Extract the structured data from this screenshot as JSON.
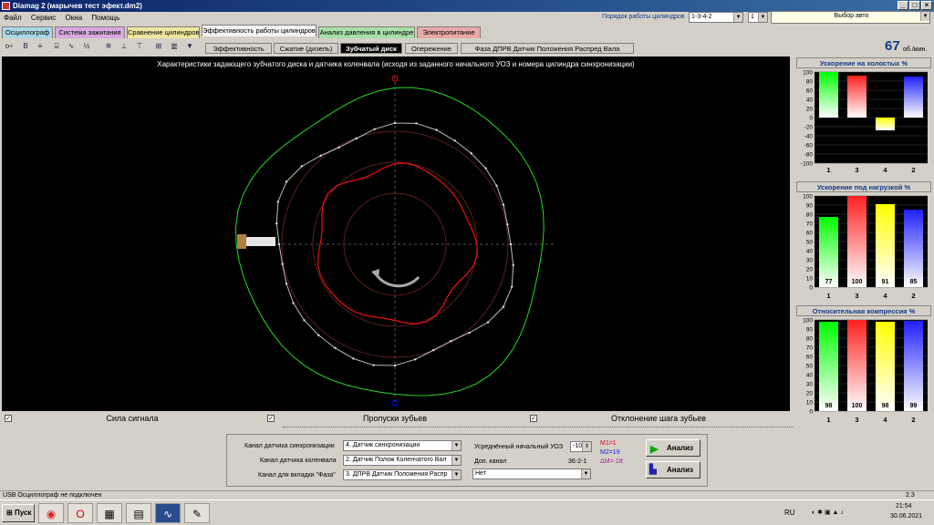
{
  "window": {
    "title": "Diamag 2 (марычев тест эфект.dm2)"
  },
  "menu": [
    "Файл",
    "Сервис",
    "Окна",
    "Помощь"
  ],
  "tabs": [
    {
      "label": "Осциллограф",
      "color": "#a8d8e8"
    },
    {
      "label": "Система зажигания",
      "color": "#d9a8e0"
    },
    {
      "label": "Сравнение цилиндров",
      "color": "#f0e6a0"
    },
    {
      "label": "Эффективность работы цилиндров",
      "color": "#f4f4f4"
    },
    {
      "label": "Анализ давления в цилиндре",
      "color": "#a8e0a8"
    },
    {
      "label": "Электропитание",
      "color": "#e8a8a8"
    }
  ],
  "subtabs": [
    "Эффективность",
    "Сжатие (дизель)",
    "Зубчатый диск",
    "Опережение",
    "Фаза ДПРВ Датчик Положения Распред Вала"
  ],
  "header": {
    "order_label": "Порядок работы цилиндров",
    "order_value": "1-3-4-2",
    "cyl_value": "1",
    "auto_select": "Выбор авто",
    "rpm_value": "67",
    "rpm_unit": "об./мин."
  },
  "plot": {
    "title": "Характеристики задающего зубчатого диска и датчика коленвала (исходя из заданного начального УОЗ и номера цилиндра синхронизации)"
  },
  "legend": [
    {
      "label": "Сила сигнала",
      "color": "#00ff00"
    },
    {
      "label": "Пропуски зубьев",
      "color": "#b0b0b0"
    },
    {
      "label": "Отклонение шага зубьев",
      "color": "#ff0000"
    }
  ],
  "bottom": {
    "sync_label": "Канал датчика синхронизации",
    "sync_value": "4. Датчик синхронизации",
    "crank_label": "Канал датчика коленвала",
    "crank_value": "2. Датчик Полож Коленчатого Вал",
    "phase_label": "Канал для вкладки \"Фаза\"",
    "phase_value": "3. ДПРВ Датчик Положения Распр",
    "uoz_label": "Усреднённый начальный УОЗ",
    "uoz_value": "-10",
    "aux_label": "Доп. канал",
    "aux_value": "Нет",
    "pattern": "36-2-1",
    "m1": "M1=1",
    "m2": "M2=19",
    "dm": "ΔM=-18",
    "analyze1": "Анализ",
    "analyze2": "Анализ"
  },
  "status": {
    "left": "USB Осциллограф не подключен",
    "right": "2.3"
  },
  "taskbar": {
    "start": "Пуск",
    "lang": "RU",
    "time": "21:54",
    "date": "30.06.2021"
  },
  "chart_data": [
    {
      "type": "bar",
      "title": "Ускорение на холостых %",
      "categories": [
        "1",
        "3",
        "4",
        "2"
      ],
      "values": [
        100,
        92,
        -28,
        90
      ],
      "ylim": [
        -100,
        100
      ],
      "yticks": [
        "100",
        "80",
        "60",
        "40",
        "20",
        "0",
        "-20",
        "-40",
        "-60",
        "-80",
        "-100"
      ],
      "colors": [
        "#00ff00",
        "#ff2020",
        "#ffff00",
        "#2020ff"
      ]
    },
    {
      "type": "bar",
      "title": "Ускорение под нагрузкой %",
      "categories": [
        "1",
        "3",
        "4",
        "2"
      ],
      "values": [
        77,
        100,
        91,
        85
      ],
      "labels": [
        "77",
        "100",
        "91",
        "85"
      ],
      "ylim": [
        0,
        100
      ],
      "yticks": [
        "100",
        "90",
        "80",
        "70",
        "60",
        "50",
        "40",
        "30",
        "20",
        "10",
        "0"
      ],
      "colors": [
        "#00ff00",
        "#ff2020",
        "#ffff00",
        "#2020ff"
      ]
    },
    {
      "type": "bar",
      "title": "Относительная компрессия %",
      "categories": [
        "1",
        "3",
        "4",
        "2"
      ],
      "values": [
        98,
        100,
        98,
        99
      ],
      "labels": [
        "98",
        "100",
        "98",
        "99"
      ],
      "ylim": [
        0,
        100
      ],
      "yticks": [
        "100",
        "90",
        "80",
        "70",
        "60",
        "50",
        "40",
        "30",
        "20",
        "10",
        "0"
      ],
      "colors": [
        "#00ff00",
        "#ff2020",
        "#ffff00",
        "#2020ff"
      ]
    }
  ]
}
